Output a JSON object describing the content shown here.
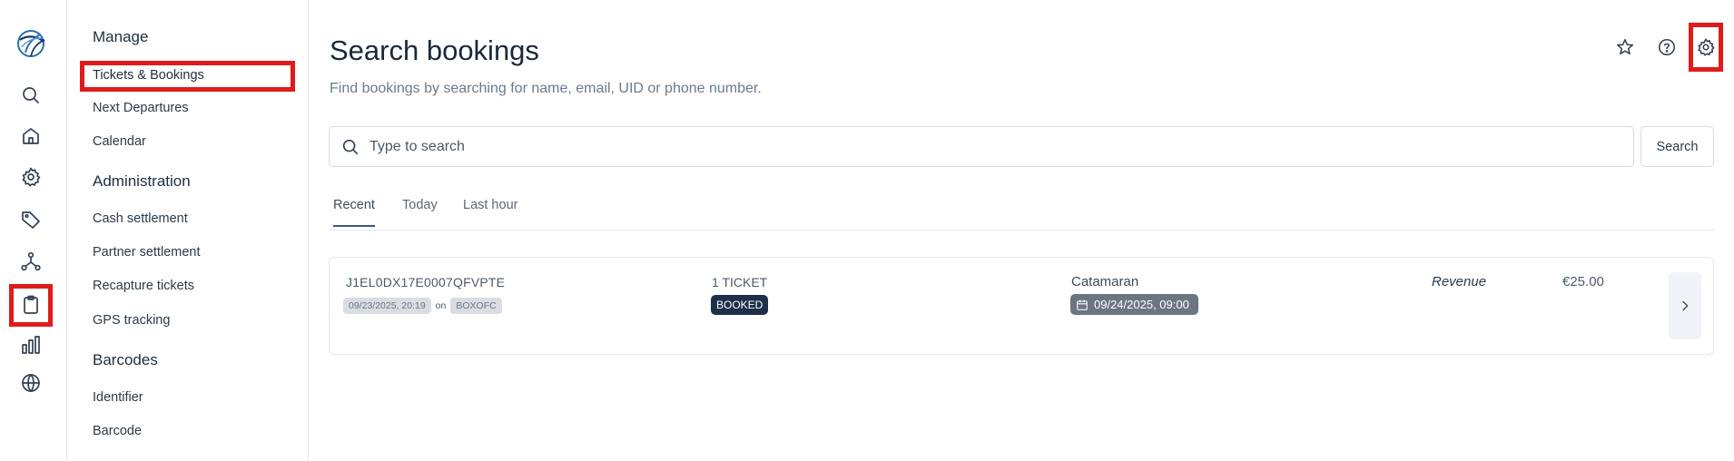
{
  "nav": {
    "sections": [
      {
        "title": "Manage",
        "items": [
          "Tickets & Bookings",
          "Next Departures",
          "Calendar"
        ]
      },
      {
        "title": "Administration",
        "items": [
          "Cash settlement",
          "Partner settlement",
          "Recapture tickets",
          "GPS tracking"
        ]
      },
      {
        "title": "Barcodes",
        "items": [
          "Identifier",
          "Barcode"
        ]
      }
    ]
  },
  "rail_icons": [
    "logo-icon",
    "search-icon",
    "home-icon",
    "gear-icon",
    "tag-icon",
    "network-icon",
    "clipboard-icon",
    "bar-chart-icon",
    "globe-icon"
  ],
  "page": {
    "title": "Search bookings",
    "subtitle": "Find bookings by searching for name, email, UID or phone number."
  },
  "search": {
    "placeholder": "Type to search",
    "value": "",
    "button_label": "Search"
  },
  "tabs": [
    {
      "label": "Recent",
      "active": true
    },
    {
      "label": "Today",
      "active": false
    },
    {
      "label": "Last hour",
      "active": false
    }
  ],
  "booking": {
    "uid": "J1EL0DX17E0007QFVPTE",
    "created": "09/23/2025, 20:19",
    "on_label": "on",
    "channel": "BOXOFC",
    "tickets": "1 TICKET",
    "status": "BOOKED",
    "product": "Catamaran",
    "departure": "09/24/2025, 09:00",
    "revenue_label": "Revenue",
    "revenue_value": "€25.00"
  },
  "colors": {
    "highlight": "#e01b1b",
    "booked_badge": "#1e2f4a",
    "date_badge": "#6b7682"
  }
}
